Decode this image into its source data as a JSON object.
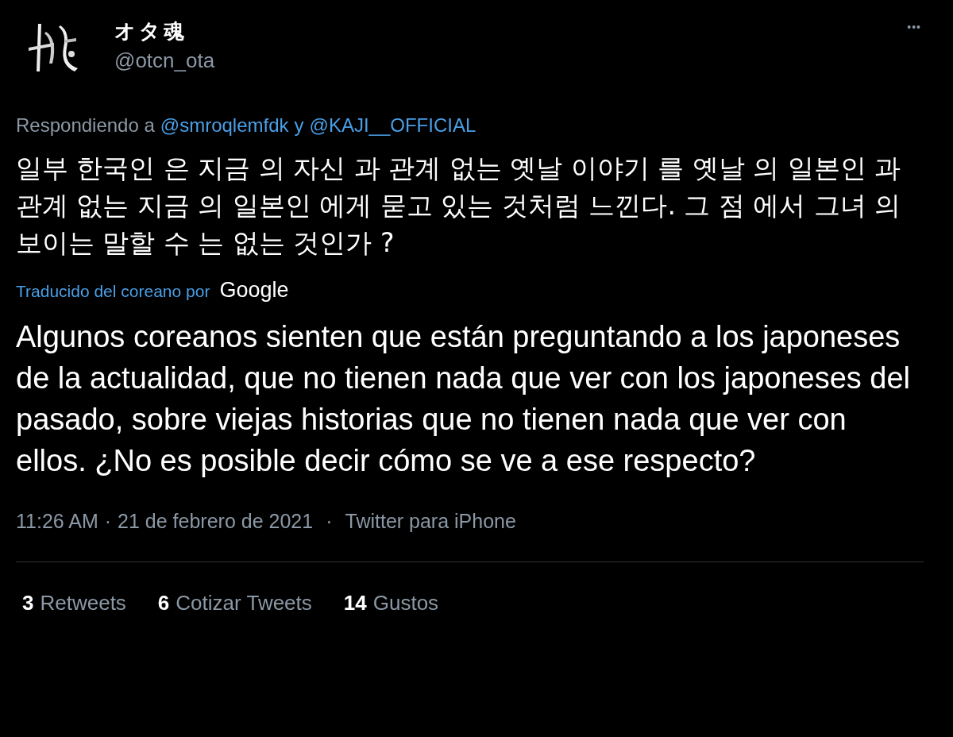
{
  "author": {
    "name": "オタ魂",
    "handle": "@otcn_ota"
  },
  "more_menu": "•••",
  "reply_to": {
    "prefix": "Respondiendo a",
    "users": [
      "@smroqlemfdk",
      "@KAJI__OFFICIAL"
    ],
    "joiner": "y"
  },
  "original_text": "일부 한국인 은 지금 의 자신 과 관계 없는 옛날 이야기 를 옛날 의 일본인 과 관계 없는 지금 의 일본인 에게 묻고 있는 것처럼 느낀다. 그 점 에서 그녀 의 보이는 말할 수 는 없는 것인가 ?",
  "translation": {
    "label": "Traducido del coreano por",
    "provider": "Google"
  },
  "translated_text": "Algunos coreanos sienten que están preguntando a los japoneses de la actualidad, que no tienen nada que ver con los japoneses del pasado, sobre viejas historias que no tienen nada que ver con ellos. ¿No es posible decir cómo se ve a ese respecto?",
  "meta": {
    "time": "11:26 AM",
    "separators": [
      "·",
      "·"
    ],
    "date": "21 de febrero de 2021",
    "source": "Twitter para iPhone"
  },
  "stats": [
    {
      "count": "3",
      "label": "Retweets"
    },
    {
      "count": "6",
      "label": "Cotizar Tweets"
    },
    {
      "count": "14",
      "label": "Gustos"
    }
  ]
}
